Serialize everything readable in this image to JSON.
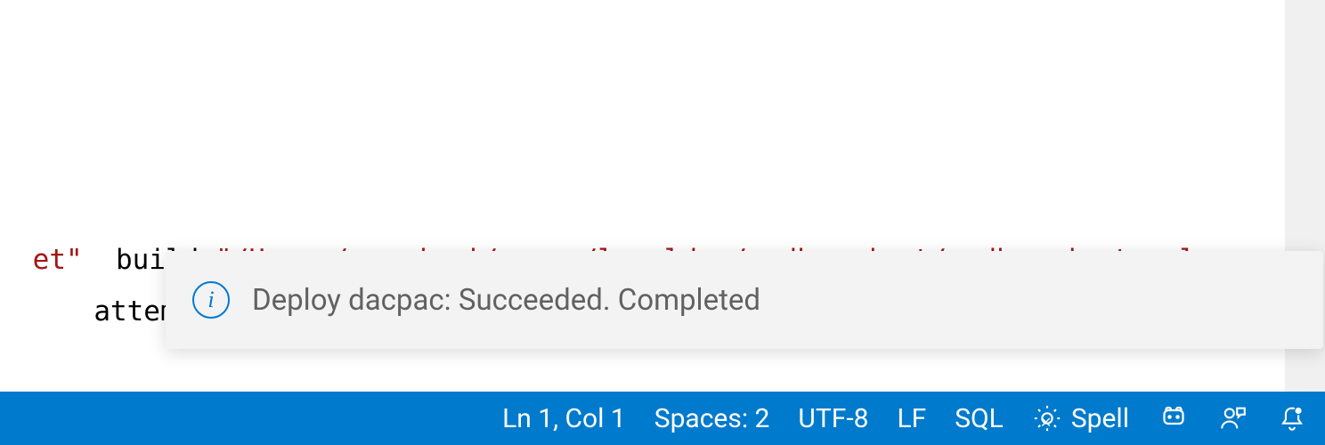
{
  "editor": {
    "line1_part1": "et\"",
    "line1_part2": "  build ",
    "line1_part3": "\"/Users/scoriani/repos/localdev/mydbproject/mydbproject.sql",
    "line2": " attempt"
  },
  "notification": {
    "icon_label": "i",
    "message": "Deploy dacpac: Succeeded. Completed"
  },
  "status_bar": {
    "cursor_position": "Ln 1, Col 1",
    "indentation": "Spaces: 2",
    "encoding": "UTF-8",
    "eol": "LF",
    "language": "SQL",
    "spell": "Spell"
  }
}
